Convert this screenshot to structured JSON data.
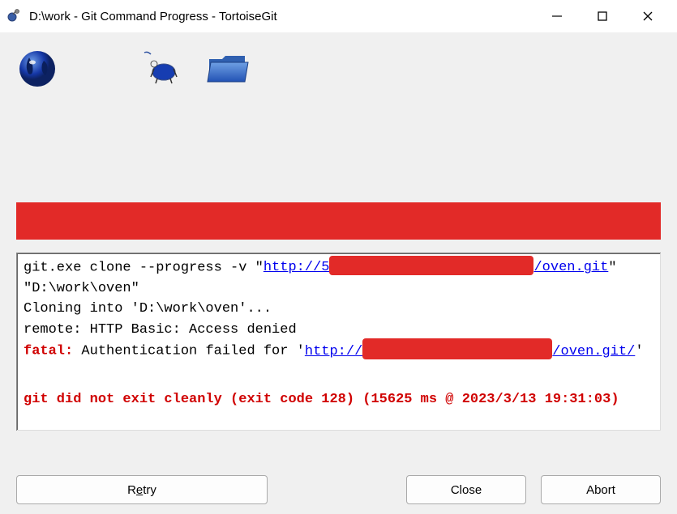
{
  "titlebar": {
    "text": "D:\\work - Git Command Progress - TortoiseGit"
  },
  "output": {
    "cmd_prefix": "git.exe clone --progress -v \"",
    "url_prefix": "http://5",
    "url_suffix": "/oven.git",
    "cmd_suffix": "\" \"D:\\work\\oven\"",
    "cloning": "Cloning into 'D:\\work\\oven'...",
    "remote": "remote: HTTP Basic: Access denied",
    "fatal_label": "fatal:",
    "fatal_text": " Authentication failed for '",
    "fatal_url_prefix": "http://",
    "fatal_url_suffix": "/oven.git/",
    "fatal_close": "'",
    "error_summary": "git did not exit cleanly (exit code 128) (15625 ms @ 2023/3/13 19:31:03)"
  },
  "buttons": {
    "retry_pre": "R",
    "retry_u": "e",
    "retry_post": "try",
    "close": "Close",
    "abort": "Abort"
  }
}
